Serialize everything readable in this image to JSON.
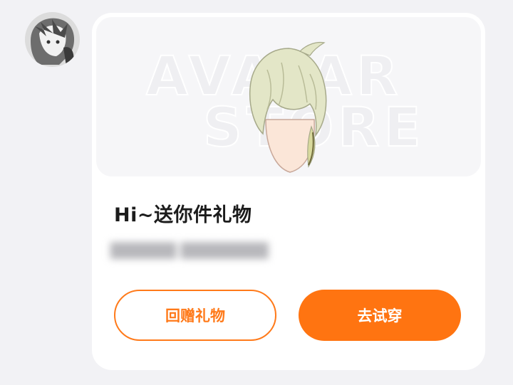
{
  "watermark": {
    "line1": "AVATAR",
    "line2": "STORE"
  },
  "message": {
    "title": "Hi~送你件礼物",
    "subtitle": "██████ ████████"
  },
  "actions": {
    "return_gift": "回赠礼物",
    "try_on": "去试穿"
  },
  "colors": {
    "accent": "#ff7411",
    "background": "#f2f2f5",
    "card": "#ffffff"
  }
}
